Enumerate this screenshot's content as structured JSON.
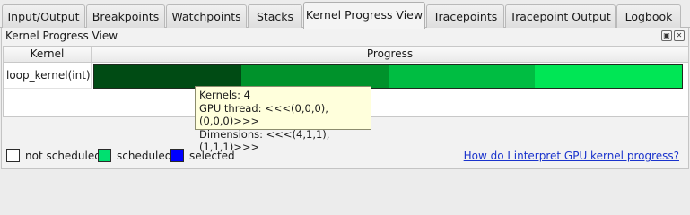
{
  "tabs": [
    {
      "label": "Input/Output"
    },
    {
      "label": "Breakpoints"
    },
    {
      "label": "Watchpoints"
    },
    {
      "label": "Stacks"
    },
    {
      "label": "Kernel Progress View"
    },
    {
      "label": "Tracepoints"
    },
    {
      "label": "Tracepoint Output"
    },
    {
      "label": "Logbook"
    }
  ],
  "panel": {
    "title": "Kernel Progress View",
    "float_icon": "float-icon",
    "close_icon": "close-icon"
  },
  "table": {
    "col_kernel": "Kernel",
    "col_progress": "Progress",
    "row": {
      "kernel": "loop_kernel(int)",
      "segments": [
        {
          "color": "#004b14"
        },
        {
          "color": "#00922b"
        },
        {
          "color": "#00bd42"
        },
        {
          "color": "#00e655"
        }
      ]
    }
  },
  "tooltip": {
    "line1": "Kernels: 4",
    "line2": "GPU thread: <<<(0,0,0),(0,0,0)>>>",
    "line3": "Dimensions: <<<(4,1,1),(1,1,1)>>>"
  },
  "legend": {
    "not_scheduled": {
      "label": "not scheduled",
      "color": "#ffffff"
    },
    "scheduled": {
      "label": "scheduled",
      "color": "#00e070"
    },
    "selected": {
      "label": "selected",
      "color": "#0000ff"
    },
    "help_link": "How do I interpret GPU kernel progress?"
  }
}
